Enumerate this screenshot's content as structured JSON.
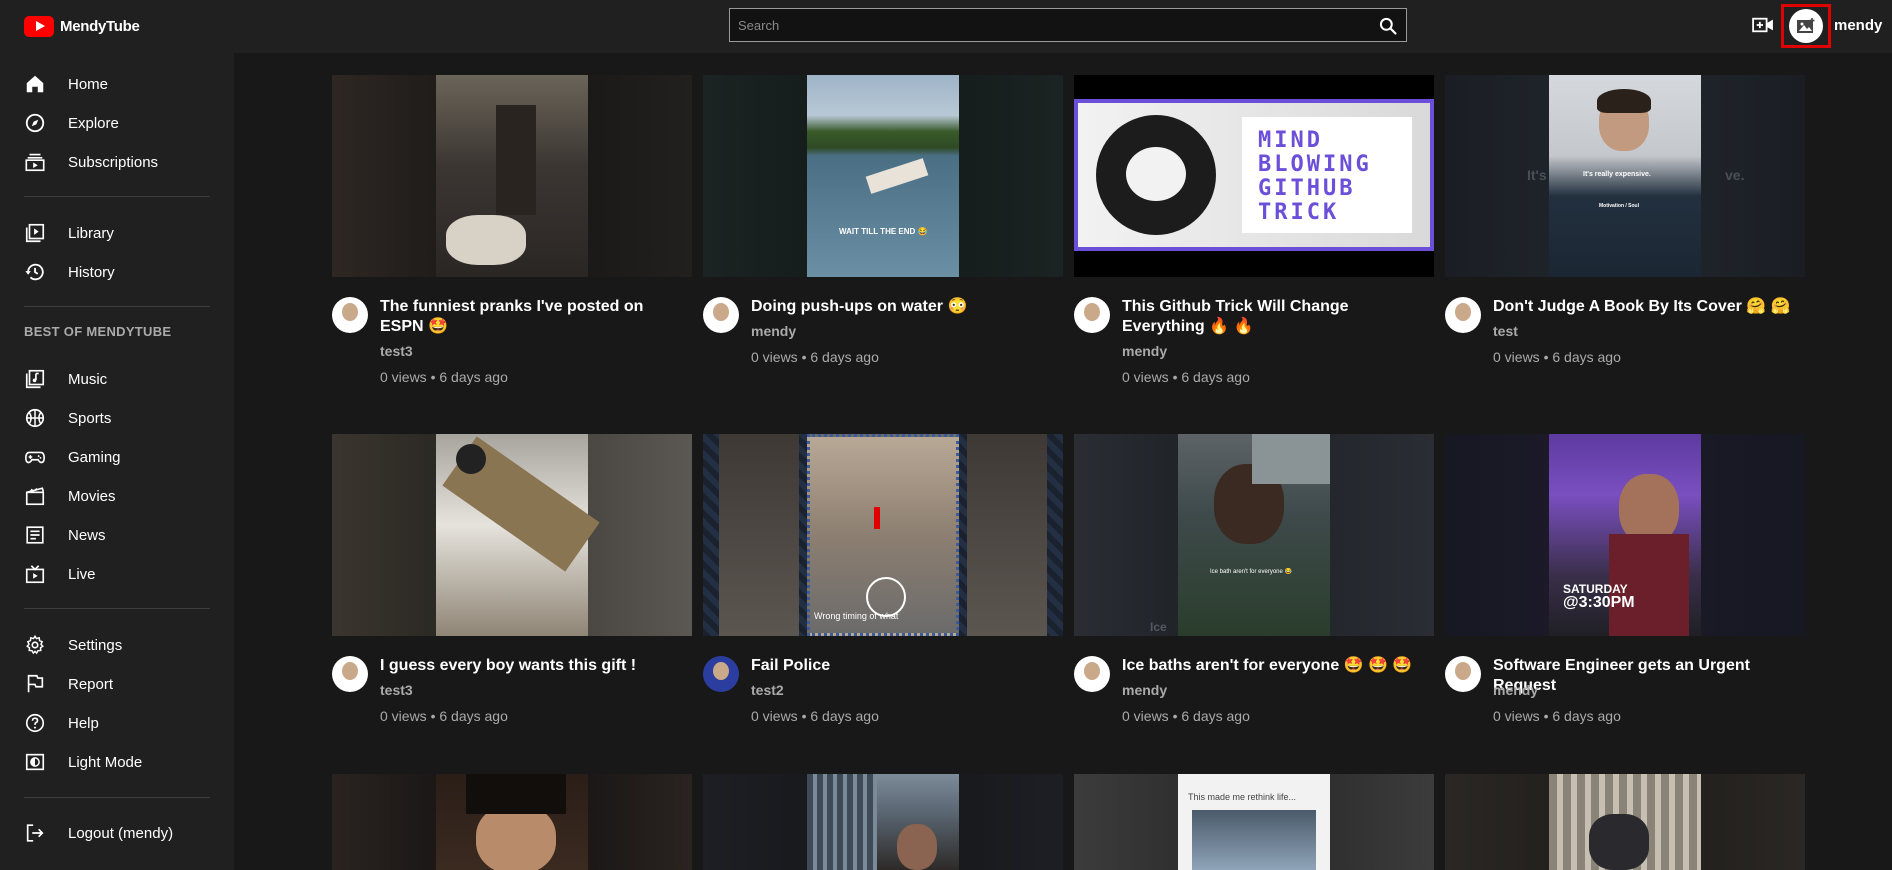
{
  "app": {
    "title": "MendyTube"
  },
  "search": {
    "placeholder": "Search"
  },
  "header": {
    "username": "mendy"
  },
  "sidebar": {
    "primary": [
      {
        "label": "Home",
        "icon": "home-icon"
      },
      {
        "label": "Explore",
        "icon": "compass-icon"
      },
      {
        "label": "Subscriptions",
        "icon": "subscriptions-icon"
      }
    ],
    "library": [
      {
        "label": "Library",
        "icon": "library-icon"
      },
      {
        "label": "History",
        "icon": "history-icon"
      }
    ],
    "best_of_title": "BEST OF MENDYTUBE",
    "best_of": [
      {
        "label": "Music",
        "icon": "music-icon"
      },
      {
        "label": "Sports",
        "icon": "sports-icon"
      },
      {
        "label": "Gaming",
        "icon": "gaming-icon"
      },
      {
        "label": "Movies",
        "icon": "movies-icon"
      },
      {
        "label": "News",
        "icon": "news-icon"
      },
      {
        "label": "Live",
        "icon": "live-icon"
      }
    ],
    "settings": [
      {
        "label": "Settings",
        "icon": "gear-icon"
      },
      {
        "label": "Report",
        "icon": "flag-icon"
      },
      {
        "label": "Help",
        "icon": "help-icon"
      },
      {
        "label": "Light Mode",
        "icon": "light-mode-icon"
      }
    ],
    "logout": {
      "label": "Logout (mendy)",
      "icon": "logout-icon"
    }
  },
  "videos": [
    {
      "title": "The funniest pranks I've posted on ESPN 🤩",
      "channel": "test3",
      "stats": "0 views • 6 days ago"
    },
    {
      "title": "Doing push-ups on water 😳",
      "channel": "mendy",
      "stats": "0 views • 6 days ago"
    },
    {
      "title": "This Github Trick Will Change Everything 🔥 🔥",
      "channel": "mendy",
      "stats": "0 views • 6 days ago"
    },
    {
      "title": "Don't Judge A Book By Its Cover 🤗 🤗",
      "channel": "test",
      "stats": "0 views • 6 days ago"
    },
    {
      "title": "I guess every boy wants this gift !",
      "channel": "test3",
      "stats": "0 views • 6 days ago"
    },
    {
      "title": "Fail Police",
      "channel": "test2",
      "stats": "0 views • 6 days ago"
    },
    {
      "title": "Ice baths aren't for everyone 🤩 🤩 🤩",
      "channel": "mendy",
      "stats": "0 views • 6 days ago"
    },
    {
      "title": "Software Engineer gets an Urgent Request",
      "channel": "mendy",
      "stats": "0 views • 6 days ago"
    }
  ],
  "thumb_text": {
    "push_ups": "WAIT TILL THE END 😂",
    "github": "MIND BLOWING GITHUB TRICK",
    "book_1": "It's",
    "book_2": "It's really expensive.",
    "book_3": "ve.",
    "book_4": "Motivation / Soul",
    "police": "Wrong timing of what",
    "ice_bath": "Ice bath aren't for everyone 😂",
    "ice": "Ice",
    "saturday": "SATURDAY",
    "time": "@3:30PM",
    "life": "This made me rethink life..."
  },
  "colors": {
    "accent": "#ff0000",
    "background": "#181818",
    "sidebar": "#202020",
    "highlight_box": "#e00000",
    "github_purple": "#6b4fd8"
  }
}
